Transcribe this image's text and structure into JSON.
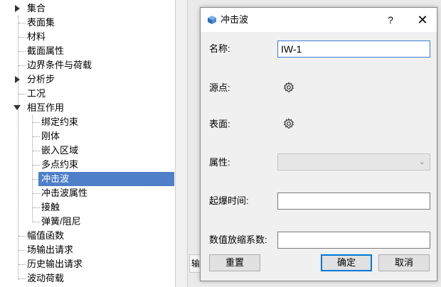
{
  "tree": {
    "items": [
      {
        "label": "集合",
        "expander": "collapsed"
      },
      {
        "label": "表面集"
      },
      {
        "label": "材料"
      },
      {
        "label": "截面属性"
      },
      {
        "label": "边界条件与荷载"
      },
      {
        "label": "分析步",
        "expander": "collapsed"
      },
      {
        "label": "工况"
      },
      {
        "label": "相互作用",
        "expander": "expanded"
      },
      {
        "label": "绑定约束"
      },
      {
        "label": "刚体"
      },
      {
        "label": "嵌入区域"
      },
      {
        "label": "多点约束"
      },
      {
        "label": "冲击波",
        "selected": true
      },
      {
        "label": "冲击波属性"
      },
      {
        "label": "接触"
      },
      {
        "label": "弹簧/阻尼"
      },
      {
        "label": "幅值函数"
      },
      {
        "label": "场输出请求"
      },
      {
        "label": "历史输出请求"
      },
      {
        "label": "波动荷载"
      }
    ]
  },
  "viewport": {
    "tab_label": "输"
  },
  "dialog": {
    "title": "冲击波",
    "help_label": "?",
    "close_label": "✕",
    "name_label": "名称:",
    "name_value": "IW-1",
    "source_label": "源点:",
    "surface_label": "表面:",
    "property_label": "属性:",
    "property_value": "",
    "detonation_label": "起爆时间:",
    "detonation_value": "",
    "scale_label": "数值放缩系数:",
    "scale_value": "",
    "reset_label": "重置",
    "ok_label": "确定",
    "cancel_label": "取消"
  },
  "icons": {
    "title_icon": "cube-icon",
    "select_icon": "gear-icon"
  },
  "colors": {
    "selection": "#4e7fc8",
    "focus": "#3c7fd6"
  }
}
